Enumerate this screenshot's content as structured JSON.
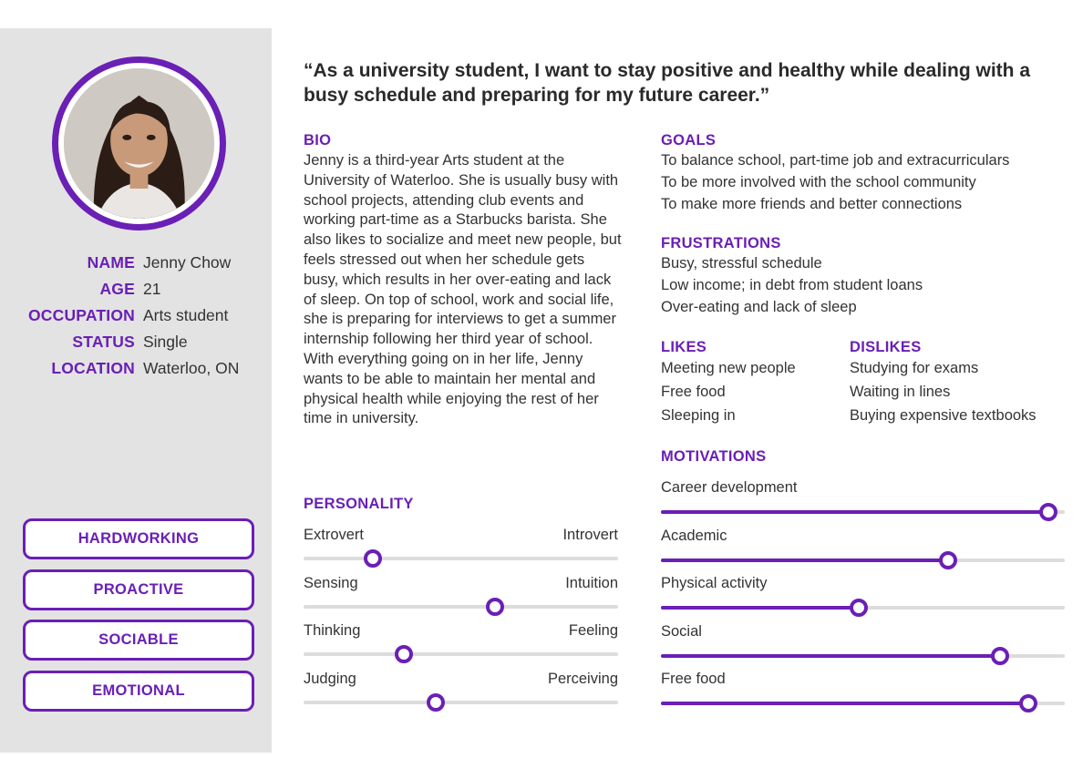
{
  "quote": "“As a university student, I want to stay positive and healthy while dealing with a busy schedule and preparing for my future career.”",
  "profile": {
    "fields": [
      {
        "label": "NAME",
        "value": "Jenny Chow"
      },
      {
        "label": "AGE",
        "value": "21"
      },
      {
        "label": "OCCUPATION",
        "value": "Arts student"
      },
      {
        "label": "STATUS",
        "value": "Single"
      },
      {
        "label": "LOCATION",
        "value": "Waterloo, ON"
      }
    ]
  },
  "traits": [
    "HARDWORKING",
    "PROACTIVE",
    "SOCIABLE",
    "EMOTIONAL"
  ],
  "bio": {
    "title": "BIO",
    "text": "Jenny is a third-year Arts student at the University of Waterloo. She is usually busy with school projects, attending club events and working part-time as a Starbucks barista. She also likes to socialize and meet new people, but feels stressed out when her schedule gets busy, which results in her over-eating and lack of sleep. On top of school, work and social life, she is preparing for interviews to get a summer internship following her third year of school. With everything going on in her life, Jenny wants to be able to maintain her mental and physical health while enjoying the rest of her time in university."
  },
  "goals": {
    "title": "GOALS",
    "items": [
      "To balance school, part-time job and extracurriculars",
      "To be more involved with the school community",
      "To make more friends and better connections"
    ]
  },
  "frustrations": {
    "title": "FRUSTRATIONS",
    "items": [
      "Busy, stressful schedule",
      "Low income; in debt from student loans",
      "Over-eating and lack of sleep"
    ]
  },
  "likes": {
    "title": "LIKES",
    "items": [
      "Meeting new people",
      "Free food",
      "Sleeping in"
    ]
  },
  "dislikes": {
    "title": "DISLIKES",
    "items": [
      "Studying for exams",
      "Waiting in lines",
      "Buying expensive textbooks"
    ]
  },
  "personality": {
    "title": "PERSONALITY",
    "scales": [
      {
        "left": "Extrovert",
        "right": "Introvert",
        "value": 0.22
      },
      {
        "left": "Sensing",
        "right": "Intuition",
        "value": 0.61
      },
      {
        "left": "Thinking",
        "right": "Feeling",
        "value": 0.32
      },
      {
        "left": "Judging",
        "right": "Perceiving",
        "value": 0.42
      }
    ]
  },
  "motivations": {
    "title": "MOTIVATIONS",
    "items": [
      {
        "label": "Career development",
        "value": 0.96
      },
      {
        "label": "Academic",
        "value": 0.71
      },
      {
        "label": "Physical activity",
        "value": 0.49
      },
      {
        "label": "Social",
        "value": 0.84
      },
      {
        "label": "Free food",
        "value": 0.91
      }
    ]
  },
  "colors": {
    "accent": "#6a1fb5",
    "sidebar": "#e3e3e3",
    "track": "#dcdcdc"
  }
}
